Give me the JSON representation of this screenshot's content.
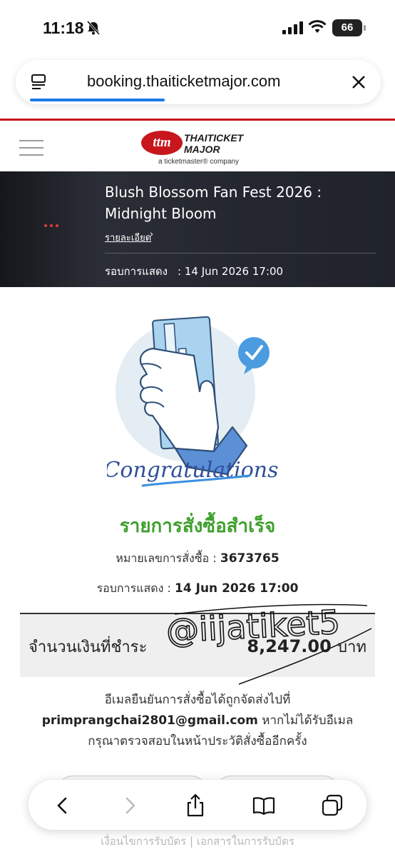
{
  "status_bar": {
    "time": "11:18",
    "battery": "66",
    "icons": [
      "bell-slash-icon",
      "signal-icon",
      "wifi-icon",
      "battery-icon"
    ]
  },
  "browser": {
    "url": "booking.thaiticketmajor.com",
    "progress": 0.4
  },
  "site": {
    "brand_line1": "THAITICKET",
    "brand_line2": "MAJOR",
    "brand_mark": "ttm",
    "tagline": "a ticketmaster® company",
    "brand_color": "#c8161d"
  },
  "event": {
    "title": "Blush Blossom Fan Fest 2026 : Midnight Bloom",
    "detail_link": "รายละเอียด",
    "show_label": "รอบการแสดง",
    "show_value": ": 14 Jun 2026 17:00"
  },
  "illustration": {
    "caption": "Congratulations"
  },
  "confirmation": {
    "title": "รายการสั่งซื้อสำเร็จ",
    "title_color": "#3fa02d",
    "order_label": "หมายเลขการสั่งซื้อ :",
    "order_number": "3673765",
    "show_label": "รอบการแสดง :",
    "show_value": "14 Jun 2026 17:00",
    "amount_label": "จำนวนเงินที่ชำระ",
    "amount_value": "8,247.00",
    "amount_unit": "บาท",
    "email_line1": "อีเมลยืนยันการสั่งซื้อได้ถูกจัดส่งไปที่",
    "email_address": "primprangchai2801@gmail.com",
    "email_line2_suffix": "หากไม่ได้รับอีเมล",
    "email_line3": "กรุณาตรวจสอบในหน้าประวัติสั่งซื้ออีกครั้ง"
  },
  "watermark": {
    "text": "@iijatiket5"
  },
  "footer": {
    "link1": "เงื่อนไขการรับบัตร",
    "separator": "|",
    "link2": "เอกสารในการรับบัตร"
  }
}
